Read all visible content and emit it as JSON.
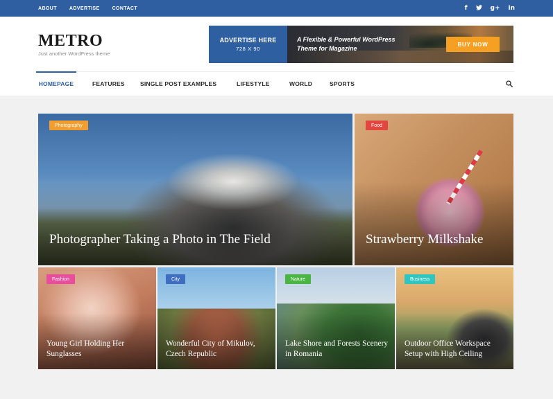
{
  "topbar": {
    "links": [
      "ABOUT",
      "ADVERTISE",
      "CONTACT"
    ],
    "social": [
      {
        "icon": "facebook-icon",
        "glyph": "f"
      },
      {
        "icon": "twitter-icon",
        "glyph": "𝕥"
      },
      {
        "icon": "google-plus-icon",
        "glyph": "g+"
      },
      {
        "icon": "linkedin-icon",
        "glyph": "in"
      }
    ],
    "color": "#2f5fa0"
  },
  "header": {
    "logo": "METRO",
    "tagline": "Just another WordPress theme"
  },
  "ad": {
    "left_line1": "ADVERTISE HERE",
    "left_line2": "728 X 90",
    "text_line1": "A Flexible & Powerful WordPress",
    "text_line2": "Theme for Magazine",
    "button": "BUY NOW",
    "button_color": "#f5a023"
  },
  "nav": {
    "items": [
      "HOMEPAGE",
      "FEATURES",
      "SINGLE POST EXAMPLES",
      "LIFESTYLE",
      "WORLD",
      "SPORTS"
    ],
    "active": "HOMEPAGE",
    "search_icon": "search-icon"
  },
  "posts": [
    {
      "category": "Photography",
      "category_color": "#f29e2e",
      "title": "Photographer Taking a Photo in The Field"
    },
    {
      "category": "Food",
      "category_color": "#e2473f",
      "title": "Strawberry Milkshake"
    },
    {
      "category": "Fashion",
      "category_color": "#e84e9c",
      "title": "Young Girl Holding Her Sunglasses"
    },
    {
      "category": "City",
      "category_color": "#3f6ec0",
      "title": "Wonderful City of Mikulov, Czech Republic"
    },
    {
      "category": "Nature",
      "category_color": "#4bb543",
      "title": "Lake Shore and Forests Scenery in Romania"
    },
    {
      "category": "Business",
      "category_color": "#2fc5c0",
      "title": "Outdoor Office Workspace Setup with High Ceiling"
    }
  ]
}
